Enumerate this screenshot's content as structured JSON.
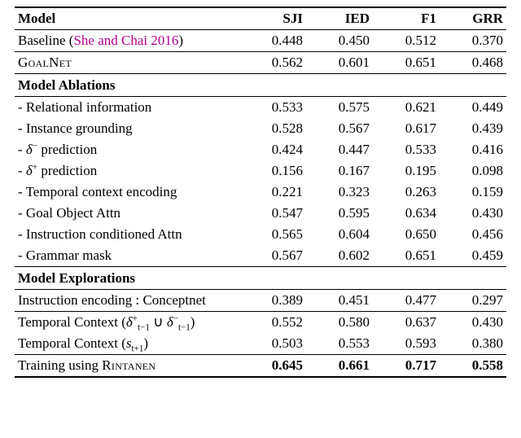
{
  "chart_data": {
    "type": "table",
    "columns": [
      "Model",
      "SJI",
      "IED",
      "F1",
      "GRR"
    ],
    "rows": [
      {
        "model": "Baseline (She and Chai 2016)",
        "SJI": 0.448,
        "IED": 0.45,
        "F1": 0.512,
        "GRR": 0.37
      },
      {
        "model": "GOALNET",
        "SJI": 0.562,
        "IED": 0.601,
        "F1": 0.651,
        "GRR": 0.468
      },
      {
        "section": "Model Ablations"
      },
      {
        "model": "- Relational information",
        "SJI": 0.533,
        "IED": 0.575,
        "F1": 0.621,
        "GRR": 0.449
      },
      {
        "model": "- Instance grounding",
        "SJI": 0.528,
        "IED": 0.567,
        "F1": 0.617,
        "GRR": 0.439
      },
      {
        "model": "- δ⁻ prediction",
        "SJI": 0.424,
        "IED": 0.447,
        "F1": 0.533,
        "GRR": 0.416
      },
      {
        "model": "- δ⁺ prediction",
        "SJI": 0.156,
        "IED": 0.167,
        "F1": 0.195,
        "GRR": 0.098
      },
      {
        "model": "- Temporal context encoding",
        "SJI": 0.221,
        "IED": 0.323,
        "F1": 0.263,
        "GRR": 0.159
      },
      {
        "model": "- Goal Object Attn",
        "SJI": 0.547,
        "IED": 0.595,
        "F1": 0.634,
        "GRR": 0.43
      },
      {
        "model": "- Instruction conditioned Attn",
        "SJI": 0.565,
        "IED": 0.604,
        "F1": 0.65,
        "GRR": 0.456
      },
      {
        "model": "- Grammar mask",
        "SJI": 0.567,
        "IED": 0.602,
        "F1": 0.651,
        "GRR": 0.459
      },
      {
        "section": "Model Explorations"
      },
      {
        "model": "Instruction encoding : Conceptnet",
        "SJI": 0.389,
        "IED": 0.451,
        "F1": 0.477,
        "GRR": 0.297
      },
      {
        "model": "Temporal Context (δ⁺_{t-1} ∪ δ⁻_{t-1})",
        "SJI": 0.552,
        "IED": 0.58,
        "F1": 0.637,
        "GRR": 0.43
      },
      {
        "model": "Temporal Context (s_{t+1})",
        "SJI": 0.503,
        "IED": 0.553,
        "F1": 0.593,
        "GRR": 0.38
      },
      {
        "model": "Training using RINTANEN",
        "SJI": 0.645,
        "IED": 0.661,
        "F1": 0.717,
        "GRR": 0.558,
        "bold": true
      }
    ]
  },
  "head": {
    "model": "Model",
    "sji": "SJI",
    "ied": "IED",
    "f1": "F1",
    "grr": "GRR"
  },
  "rows": {
    "baseline_prefix": "Baseline (",
    "baseline_cite": "She and Chai 2016",
    "baseline_suffix": ")",
    "baseline": {
      "sji": "0.448",
      "ied": "0.450",
      "f1": "0.512",
      "grr": "0.370"
    },
    "goalnet_label": "GoalNet",
    "goalnet": {
      "sji": "0.562",
      "ied": "0.601",
      "f1": "0.651",
      "grr": "0.468"
    },
    "ablations_header": "Model Ablations",
    "ab_rel": {
      "label": "- Relational information",
      "sji": "0.533",
      "ied": "0.575",
      "f1": "0.621",
      "grr": "0.449"
    },
    "ab_inst": {
      "label": "- Instance grounding",
      "sji": "0.528",
      "ied": "0.567",
      "f1": "0.617",
      "grr": "0.439"
    },
    "ab_dminus_prefix": "- ",
    "ab_dminus_delta": "δ",
    "ab_dminus_sup": "−",
    "ab_dminus_suffix": " prediction",
    "ab_dminus": {
      "sji": "0.424",
      "ied": "0.447",
      "f1": "0.533",
      "grr": "0.416"
    },
    "ab_dplus_sup": "+",
    "ab_dplus": {
      "sji": "0.156",
      "ied": "0.167",
      "f1": "0.195",
      "grr": "0.098"
    },
    "ab_temp": {
      "label": "- Temporal context encoding",
      "sji": "0.221",
      "ied": "0.323",
      "f1": "0.263",
      "grr": "0.159"
    },
    "ab_goal": {
      "label": "- Goal Object Attn",
      "sji": "0.547",
      "ied": "0.595",
      "f1": "0.634",
      "grr": "0.430"
    },
    "ab_instr": {
      "label": "- Instruction conditioned Attn",
      "sji": "0.565",
      "ied": "0.604",
      "f1": "0.650",
      "grr": "0.456"
    },
    "ab_gram": {
      "label": "- Grammar mask",
      "sji": "0.567",
      "ied": "0.602",
      "f1": "0.651",
      "grr": "0.459"
    },
    "expl_header": "Model Explorations",
    "ex_concept": {
      "label": "Instruction encoding : Conceptnet",
      "sji": "0.389",
      "ied": "0.451",
      "f1": "0.477",
      "grr": "0.297"
    },
    "ex_tc1_prefix": "Temporal Context (",
    "ex_tc1_d": "δ",
    "ex_tc1_p": "+",
    "ex_tc1_sub1": "t−1",
    "ex_tc1_cup": " ∪ ",
    "ex_tc1_m": "−",
    "ex_tc1_suffix": ")",
    "ex_tc1": {
      "sji": "0.552",
      "ied": "0.580",
      "f1": "0.637",
      "grr": "0.430"
    },
    "ex_tc2_prefix": "Temporal Context (",
    "ex_tc2_s": "s",
    "ex_tc2_sub": "t+1",
    "ex_tc2_suffix": ")",
    "ex_tc2": {
      "sji": "0.503",
      "ied": "0.553",
      "f1": "0.593",
      "grr": "0.380"
    },
    "ex_rint_prefix": "Training using ",
    "ex_rint_name": "Rintanen",
    "ex_rint": {
      "sji": "0.645",
      "ied": "0.661",
      "f1": "0.717",
      "grr": "0.558"
    }
  }
}
